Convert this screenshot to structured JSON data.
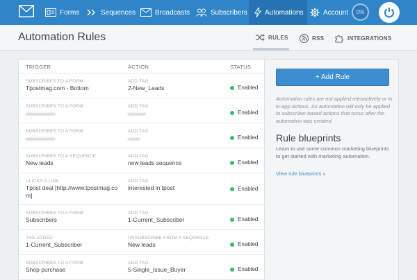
{
  "nav": {
    "items": [
      {
        "label": "Forms",
        "icon": "forms-icon"
      },
      {
        "label": "Sequences",
        "icon": "sequences-icon"
      },
      {
        "label": "Broadcasts",
        "icon": "broadcasts-icon"
      },
      {
        "label": "Subscribers",
        "icon": "subscribers-icon"
      },
      {
        "label": "Automations",
        "icon": "lightning-icon",
        "active": true
      },
      {
        "label": "Account",
        "icon": "gear-icon"
      }
    ],
    "progress": "0%"
  },
  "page": {
    "title": "Automation Rules",
    "tabs": [
      {
        "label": "RULES",
        "icon": "shuffle-icon",
        "active": true
      },
      {
        "label": "RSS",
        "icon": "rss-icon"
      },
      {
        "label": "INTEGRATIONS",
        "icon": "puzzle-icon"
      }
    ]
  },
  "table": {
    "headers": {
      "trigger": "TRIGGER",
      "action": "ACTION",
      "status": "STATUS"
    },
    "rows": [
      {
        "trigger_cat": "SUBSCRIBES TO A FORM",
        "trigger": "Tpostmag.com - Bottom",
        "action_cat": "ADD TAG",
        "action": "2-New_Leads",
        "status": "Enabled"
      },
      {
        "trigger_cat": "SUBSCRIBES TO A FORM",
        "trigger": "",
        "action_cat": "ADD TAG",
        "action": "",
        "status": "Enabled"
      },
      {
        "trigger_cat": "SUBSCRIBES TO A FORM",
        "trigger": "",
        "action_cat": "ADD TAG",
        "action": "",
        "status": "Enabled"
      },
      {
        "trigger_cat": "SUBSCRIBES TO A SEQUENCE",
        "trigger": "New leads",
        "action_cat": "ADD TAG",
        "action": "new leads sequence",
        "status": "Enabled"
      },
      {
        "trigger_cat": "CLICKS A LINK",
        "trigger": "Tpost deal [http://www.tpostmag.com]",
        "action_cat": "ADD TAG",
        "action": "interested in tpost",
        "status": "Enabled"
      },
      {
        "trigger_cat": "SUBSCRIBES TO A FORM",
        "trigger": "Subscribers",
        "action_cat": "ADD TAG",
        "action": "1-Current_Subscriber",
        "status": "Enabled"
      },
      {
        "trigger_cat": "TAG ADDED",
        "trigger": "1-Current_Subscriber",
        "action_cat": "UNSUBSCRIBE FROM A SEQUENCE",
        "action": "New leads",
        "status": "Enabled"
      },
      {
        "trigger_cat": "SUBSCRIBES TO A FORM",
        "trigger": "Shop purchase",
        "action_cat": "ADD TAG",
        "action": "5-Single_Issue_Buyer",
        "status": "Enabled"
      }
    ]
  },
  "sidebar": {
    "add_rule_label": "+ Add Rule",
    "note": "Automation rules are not applied retroactively or to in-app actions. An automation will only be applied to subscriber-based actions that occur after the automation was created.",
    "blueprints_title": "Rule blueprints",
    "blueprints_text": "Learn to use some common marketing blueprints to get started with marketing automation.",
    "blueprints_link": "View rule blueprints »"
  },
  "colors": {
    "nav_bg": "#2f85c8",
    "accent": "#3d8ed0",
    "enabled": "#3dbb6b"
  }
}
